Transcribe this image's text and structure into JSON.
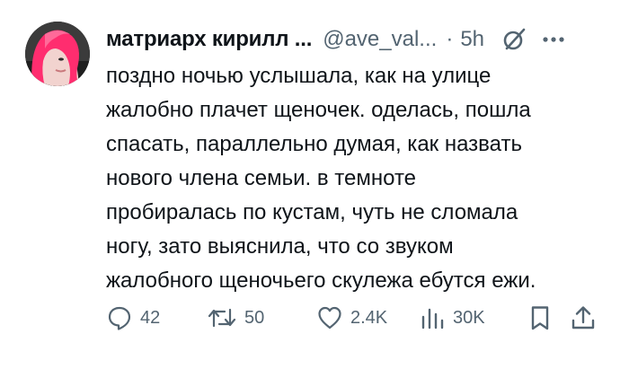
{
  "author": {
    "display_name": "матриарх кирилл ...",
    "handle": "@ave_val...",
    "separator": "·",
    "time": "5h"
  },
  "tweet": {
    "lines": [
      "поздно ночью услышала, как на улице",
      "жалобно плачет щеночек. оделась, пошла",
      "спасать, параллельно думая, как назвать",
      "нового члена семьи. в темноте",
      "пробиралась по кустам, чуть не сломала",
      "ногу, зато выяснила, что со звуком",
      "жалобного щеночьего скулежа ебутся ежи."
    ]
  },
  "actions": {
    "replies": "42",
    "reposts": "50",
    "likes": "2.4K",
    "views": "30K"
  },
  "icons": {
    "reply": "reply-icon",
    "repost": "repost-icon",
    "like": "heart-icon",
    "views": "views-icon",
    "bookmark": "bookmark-icon",
    "share": "share-icon",
    "grok": "grok-icon",
    "more": "more-icon"
  },
  "colors": {
    "text": "#0f1419",
    "secondary": "#536471",
    "background": "#ffffff",
    "avatar_hair": "#ff2d6f"
  }
}
